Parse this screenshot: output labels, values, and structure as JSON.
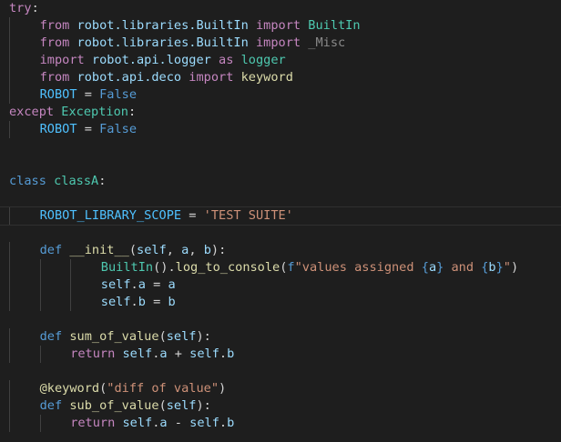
{
  "editor": {
    "lines": [
      {
        "indent": 0,
        "tokens": [
          {
            "t": "try",
            "c": "keyword"
          },
          {
            "t": ":",
            "c": "plain"
          }
        ]
      },
      {
        "indent": 1,
        "tokens": [
          {
            "t": "from",
            "c": "keyword"
          },
          {
            "t": " ",
            "c": "plain"
          },
          {
            "t": "robot.libraries.BuiltIn",
            "c": "variable"
          },
          {
            "t": " ",
            "c": "plain"
          },
          {
            "t": "import",
            "c": "keyword"
          },
          {
            "t": " ",
            "c": "plain"
          },
          {
            "t": "BuiltIn",
            "c": "class"
          }
        ]
      },
      {
        "indent": 1,
        "tokens": [
          {
            "t": "from",
            "c": "keyword"
          },
          {
            "t": " ",
            "c": "plain"
          },
          {
            "t": "robot.libraries.BuiltIn",
            "c": "variable"
          },
          {
            "t": " ",
            "c": "plain"
          },
          {
            "t": "import",
            "c": "keyword"
          },
          {
            "t": " ",
            "c": "plain"
          },
          {
            "t": "_Misc",
            "c": "dim"
          }
        ]
      },
      {
        "indent": 1,
        "tokens": [
          {
            "t": "import",
            "c": "keyword"
          },
          {
            "t": " ",
            "c": "plain"
          },
          {
            "t": "robot.api.logger",
            "c": "variable"
          },
          {
            "t": " ",
            "c": "plain"
          },
          {
            "t": "as",
            "c": "keyword"
          },
          {
            "t": " ",
            "c": "plain"
          },
          {
            "t": "logger",
            "c": "class"
          }
        ]
      },
      {
        "indent": 1,
        "tokens": [
          {
            "t": "from",
            "c": "keyword"
          },
          {
            "t": " ",
            "c": "plain"
          },
          {
            "t": "robot.api.deco",
            "c": "variable"
          },
          {
            "t": " ",
            "c": "plain"
          },
          {
            "t": "import",
            "c": "keyword"
          },
          {
            "t": " ",
            "c": "plain"
          },
          {
            "t": "keyword",
            "c": "function"
          }
        ]
      },
      {
        "indent": 1,
        "tokens": [
          {
            "t": "ROBOT",
            "c": "constant"
          },
          {
            "t": " = ",
            "c": "plain"
          },
          {
            "t": "False",
            "c": "boolean"
          }
        ]
      },
      {
        "indent": 0,
        "tokens": [
          {
            "t": "except",
            "c": "keyword"
          },
          {
            "t": " ",
            "c": "plain"
          },
          {
            "t": "Exception",
            "c": "class"
          },
          {
            "t": ":",
            "c": "plain"
          }
        ]
      },
      {
        "indent": 1,
        "tokens": [
          {
            "t": "ROBOT",
            "c": "constant"
          },
          {
            "t": " = ",
            "c": "plain"
          },
          {
            "t": "False",
            "c": "boolean"
          }
        ]
      },
      {
        "indent": 0,
        "tokens": []
      },
      {
        "indent": 0,
        "tokens": []
      },
      {
        "indent": 0,
        "tokens": [
          {
            "t": "class",
            "c": "storage"
          },
          {
            "t": " ",
            "c": "plain"
          },
          {
            "t": "classA",
            "c": "class"
          },
          {
            "t": ":",
            "c": "plain"
          }
        ]
      },
      {
        "indent": 0,
        "tokens": []
      },
      {
        "indent": 1,
        "tokens": [
          {
            "t": "ROBOT_LIBRARY_SCOPE",
            "c": "constant"
          },
          {
            "t": " = ",
            "c": "plain"
          },
          {
            "t": "'TEST SUITE'",
            "c": "string"
          }
        ]
      },
      {
        "indent": 0,
        "tokens": []
      },
      {
        "indent": 1,
        "tokens": [
          {
            "t": "def",
            "c": "storage"
          },
          {
            "t": " ",
            "c": "plain"
          },
          {
            "t": "__init__",
            "c": "function"
          },
          {
            "t": "(",
            "c": "plain"
          },
          {
            "t": "self",
            "c": "variable"
          },
          {
            "t": ", ",
            "c": "plain"
          },
          {
            "t": "a",
            "c": "variable"
          },
          {
            "t": ", ",
            "c": "plain"
          },
          {
            "t": "b",
            "c": "variable"
          },
          {
            "t": "):",
            "c": "plain"
          }
        ]
      },
      {
        "indent": 3,
        "tokens": [
          {
            "t": "BuiltIn",
            "c": "class"
          },
          {
            "t": "().",
            "c": "plain"
          },
          {
            "t": "log_to_console",
            "c": "function"
          },
          {
            "t": "(",
            "c": "plain"
          },
          {
            "t": "f",
            "c": "storage"
          },
          {
            "t": "\"values assigned ",
            "c": "string"
          },
          {
            "t": "{",
            "c": "storage"
          },
          {
            "t": "a",
            "c": "variable"
          },
          {
            "t": "}",
            "c": "storage"
          },
          {
            "t": " and ",
            "c": "string"
          },
          {
            "t": "{",
            "c": "storage"
          },
          {
            "t": "b",
            "c": "variable"
          },
          {
            "t": "}",
            "c": "storage"
          },
          {
            "t": "\"",
            "c": "string"
          },
          {
            "t": ")",
            "c": "plain"
          }
        ]
      },
      {
        "indent": 3,
        "tokens": [
          {
            "t": "self",
            "c": "variable"
          },
          {
            "t": ".",
            "c": "plain"
          },
          {
            "t": "a",
            "c": "variable"
          },
          {
            "t": " = ",
            "c": "plain"
          },
          {
            "t": "a",
            "c": "variable"
          }
        ]
      },
      {
        "indent": 3,
        "tokens": [
          {
            "t": "self",
            "c": "variable"
          },
          {
            "t": ".",
            "c": "plain"
          },
          {
            "t": "b",
            "c": "variable"
          },
          {
            "t": " = ",
            "c": "plain"
          },
          {
            "t": "b",
            "c": "variable"
          }
        ]
      },
      {
        "indent": 0,
        "tokens": []
      },
      {
        "indent": 1,
        "tokens": [
          {
            "t": "def",
            "c": "storage"
          },
          {
            "t": " ",
            "c": "plain"
          },
          {
            "t": "sum_of_value",
            "c": "function"
          },
          {
            "t": "(",
            "c": "plain"
          },
          {
            "t": "self",
            "c": "variable"
          },
          {
            "t": "):",
            "c": "plain"
          }
        ]
      },
      {
        "indent": 2,
        "tokens": [
          {
            "t": "return",
            "c": "keyword"
          },
          {
            "t": " ",
            "c": "plain"
          },
          {
            "t": "self",
            "c": "variable"
          },
          {
            "t": ".",
            "c": "plain"
          },
          {
            "t": "a",
            "c": "variable"
          },
          {
            "t": " + ",
            "c": "plain"
          },
          {
            "t": "self",
            "c": "variable"
          },
          {
            "t": ".",
            "c": "plain"
          },
          {
            "t": "b",
            "c": "variable"
          }
        ]
      },
      {
        "indent": 0,
        "tokens": []
      },
      {
        "indent": 1,
        "tokens": [
          {
            "t": "@keyword",
            "c": "function"
          },
          {
            "t": "(",
            "c": "plain"
          },
          {
            "t": "\"diff of value\"",
            "c": "string"
          },
          {
            "t": ")",
            "c": "plain"
          }
        ]
      },
      {
        "indent": 1,
        "tokens": [
          {
            "t": "def",
            "c": "storage"
          },
          {
            "t": " ",
            "c": "plain"
          },
          {
            "t": "sub_of_value",
            "c": "function"
          },
          {
            "t": "(",
            "c": "plain"
          },
          {
            "t": "self",
            "c": "variable"
          },
          {
            "t": "):",
            "c": "plain"
          }
        ]
      },
      {
        "indent": 2,
        "tokens": [
          {
            "t": "return",
            "c": "keyword"
          },
          {
            "t": " ",
            "c": "plain"
          },
          {
            "t": "self",
            "c": "variable"
          },
          {
            "t": ".",
            "c": "plain"
          },
          {
            "t": "a",
            "c": "variable"
          },
          {
            "t": " - ",
            "c": "plain"
          },
          {
            "t": "self",
            "c": "variable"
          },
          {
            "t": ".",
            "c": "plain"
          },
          {
            "t": "b",
            "c": "variable"
          }
        ]
      }
    ]
  },
  "theme": {
    "background": "#1e1e1e",
    "keyword": "#c586c0",
    "storage": "#569cd6",
    "class": "#4ec9b0",
    "function": "#dcdcaa",
    "variable": "#9cdcfe",
    "constant": "#4fc1ff",
    "string": "#ce9178",
    "plain": "#d4d4d4"
  }
}
